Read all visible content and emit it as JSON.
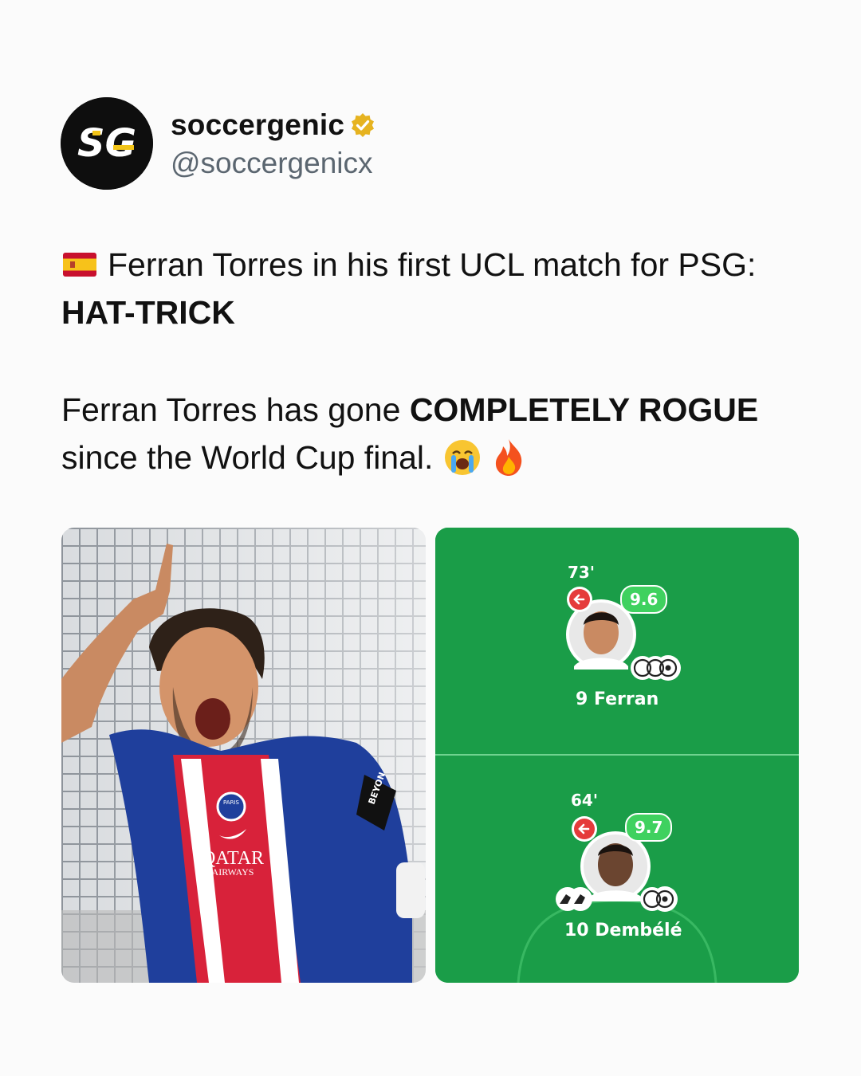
{
  "account": {
    "display_name": "soccergenic",
    "handle": "@soccergenicx",
    "avatar_text": "SG",
    "verified": true,
    "avatar_icon": "sg-logo-icon",
    "verified_icon": "verified-badge-icon"
  },
  "tweet": {
    "line1_flag": "spain-flag-icon",
    "line1_text": "Ferran Torres in his first UCL match for PSG: ",
    "line1_bold": "HAT-TRICK",
    "line2_text": "Ferran Torres has gone ",
    "line2_bold": "COMPLETELY ROGUE",
    "line2_tail": " since the World Cup final.",
    "emojis": [
      "crying-face-icon",
      "fire-icon"
    ]
  },
  "media": {
    "photo": {
      "icon": "player-celebration-photo",
      "shirt_crest_text": "PARIS",
      "sponsor_line1": "QATAR",
      "sponsor_line2": "AIRWAYS",
      "armband_text": "BEYON"
    },
    "ratings": {
      "players": [
        {
          "minute": "73'",
          "rating": "9.6",
          "name": "9 Ferran",
          "goals": 3,
          "assists": 0
        },
        {
          "minute": "64'",
          "rating": "9.7",
          "name": "10 Dembélé",
          "goals": 2,
          "assists": 2
        }
      ]
    }
  },
  "colors": {
    "pitch": "#1a9d48",
    "rating_badge": "#3fd15f",
    "sub_icon": "#e53b3b",
    "avatar_bg": "#0e0e0e",
    "avatar_accent": "#f2c418",
    "verified": "#e6b320"
  }
}
